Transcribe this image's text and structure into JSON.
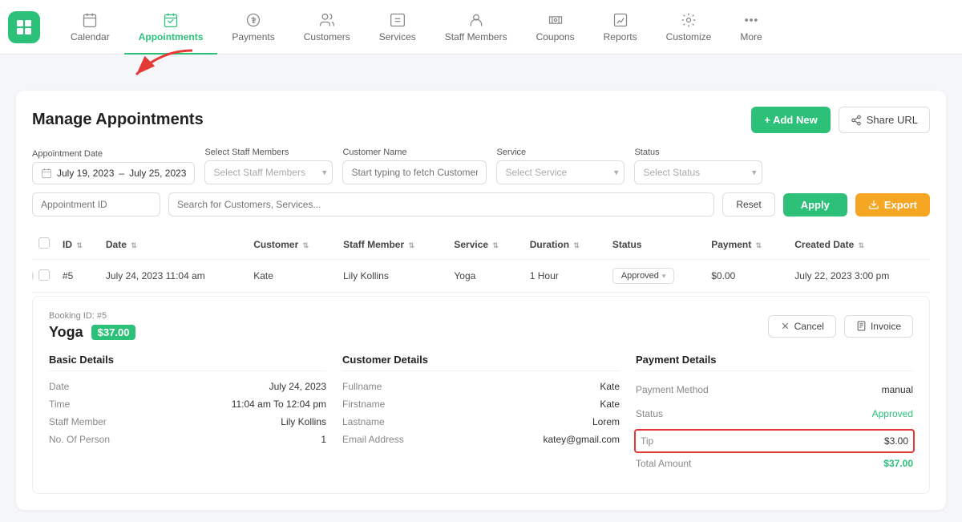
{
  "nav": {
    "items": [
      {
        "id": "calendar",
        "label": "Calendar",
        "active": false
      },
      {
        "id": "appointments",
        "label": "Appointments",
        "active": true
      },
      {
        "id": "payments",
        "label": "Payments",
        "active": false
      },
      {
        "id": "customers",
        "label": "Customers",
        "active": false
      },
      {
        "id": "services",
        "label": "Services",
        "active": false
      },
      {
        "id": "staff-members",
        "label": "Staff Members",
        "active": false
      },
      {
        "id": "coupons",
        "label": "Coupons",
        "active": false
      },
      {
        "id": "reports",
        "label": "Reports",
        "active": false
      },
      {
        "id": "customize",
        "label": "Customize",
        "active": false
      },
      {
        "id": "more",
        "label": "More",
        "active": false
      }
    ]
  },
  "page": {
    "title": "Manage Appointments",
    "add_button": "+ Add New",
    "share_button": "Share URL"
  },
  "filters": {
    "appointment_date_label": "Appointment Date",
    "date_from": "July 19, 2023",
    "date_to": "July 25, 2023",
    "staff_label": "Select Staff Members",
    "staff_placeholder": "Select Staff Members",
    "customer_label": "Customer Name",
    "customer_placeholder": "Start typing to fetch Customer",
    "service_label": "Service",
    "service_placeholder": "Select Service",
    "status_label": "Status",
    "status_placeholder": "Select Status",
    "appointment_id_placeholder": "Appointment ID",
    "search_placeholder": "Search for Customers, Services...",
    "reset_label": "Reset",
    "apply_label": "Apply",
    "export_label": "Export"
  },
  "table": {
    "columns": [
      "ID",
      "Date",
      "Customer",
      "Staff Member",
      "Service",
      "Duration",
      "Status",
      "Payment",
      "Created Date"
    ],
    "rows": [
      {
        "id": "#5",
        "date": "July 24, 2023 11:04 am",
        "customer": "Kate",
        "staff_member": "Lily Kollins",
        "service": "Yoga",
        "duration": "1 Hour",
        "status": "Approved",
        "payment": "$0.00",
        "created_date": "July 22, 2023 3:00 pm"
      }
    ]
  },
  "booking": {
    "booking_id_label": "Booking ID: #5",
    "title": "Yoga",
    "price": "$37.00",
    "cancel_label": "Cancel",
    "invoice_label": "Invoice",
    "basic_details": {
      "section_title": "Basic Details",
      "date_label": "Date",
      "date_value": "July 24, 2023",
      "time_label": "Time",
      "time_value": "11:04 am To 12:04 pm",
      "staff_label": "Staff Member",
      "staff_value": "Lily Kollins",
      "person_label": "No. Of Person",
      "person_value": "1"
    },
    "customer_details": {
      "section_title": "Customer Details",
      "fullname_label": "Fullname",
      "fullname_value": "Kate",
      "firstname_label": "Firstname",
      "firstname_value": "Kate",
      "lastname_label": "Lastname",
      "lastname_value": "Lorem",
      "email_label": "Email Address",
      "email_value": "katey@gmail.com"
    },
    "payment_details": {
      "section_title": "Payment Details",
      "method_label": "Payment Method",
      "method_value": "manual",
      "status_label": "Status",
      "status_value": "Approved",
      "tip_label": "Tip",
      "tip_value": "$3.00",
      "total_label": "Total Amount",
      "total_value": "$37.00"
    }
  }
}
